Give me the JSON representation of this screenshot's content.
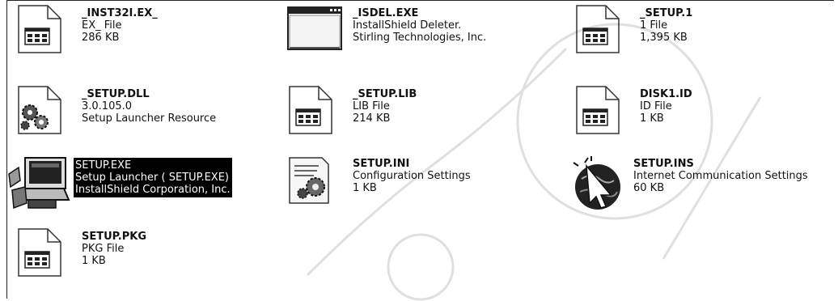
{
  "files": [
    {
      "name": "_INST32I.EX_",
      "line1": "EX_ File",
      "line2": "286 KB",
      "icon": "generic-file"
    },
    {
      "name": "_ISDEL.EXE",
      "line1": "InstallShield Deleter.",
      "line2": "Stirling Technologies, Inc.",
      "icon": "window"
    },
    {
      "name": "_SETUP.1",
      "line1": "1 File",
      "line2": "1,395 KB",
      "icon": "generic-file"
    },
    {
      "name": "_SETUP.DLL",
      "line1": "3.0.105.0",
      "line2": "Setup Launcher Resource",
      "icon": "gears-dll"
    },
    {
      "name": "_SETUP.LIB",
      "line1": "LIB File",
      "line2": "214 KB",
      "icon": "generic-file"
    },
    {
      "name": "DISK1.ID",
      "line1": "ID File",
      "line2": "1 KB",
      "icon": "generic-file"
    },
    {
      "name": "SETUP.EXE",
      "line1": "Setup Launcher ( SETUP.EXE)",
      "line2": "InstallShield Corporation, Inc.",
      "icon": "installer-computer",
      "selected": true
    },
    {
      "name": "SETUP.INI",
      "line1": "Configuration Settings",
      "line2": "1 KB",
      "icon": "config-settings"
    },
    {
      "name": "SETUP.INS",
      "line1": "Internet Communication Settings",
      "line2": "60 KB",
      "icon": "internet-settings"
    },
    {
      "name": "SETUP.PKG",
      "line1": "PKG File",
      "line2": "1 KB",
      "icon": "generic-file"
    }
  ]
}
